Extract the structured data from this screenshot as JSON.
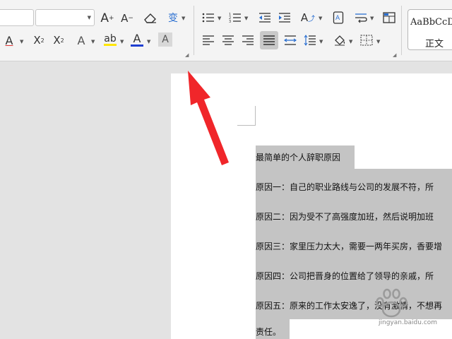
{
  "ribbon": {
    "style_gallery": {
      "sample": "AaBbCcD",
      "name": "正文"
    }
  },
  "document": {
    "lines": [
      "最简单的个人辞职原因",
      "原因一：自己的职业路线与公司的发展不符，所",
      "原因二：因为受不了高强度加班，然后说明加班",
      "原因三：家里压力太大，需要一两年买房，香要增",
      "原因四：公司把晋身的位置给了领导的亲戚，所",
      "原因五：原来的工作太安逸了，没有激情，不想再",
      "责任。"
    ]
  },
  "watermark": {
    "text": "jingyan.baidu.com"
  },
  "colors": {
    "arrow": "#f0262a",
    "selection": "#c4c4c4",
    "highlight_yellow": "#ffe600",
    "font_color_blue": "#1f3fd1"
  }
}
